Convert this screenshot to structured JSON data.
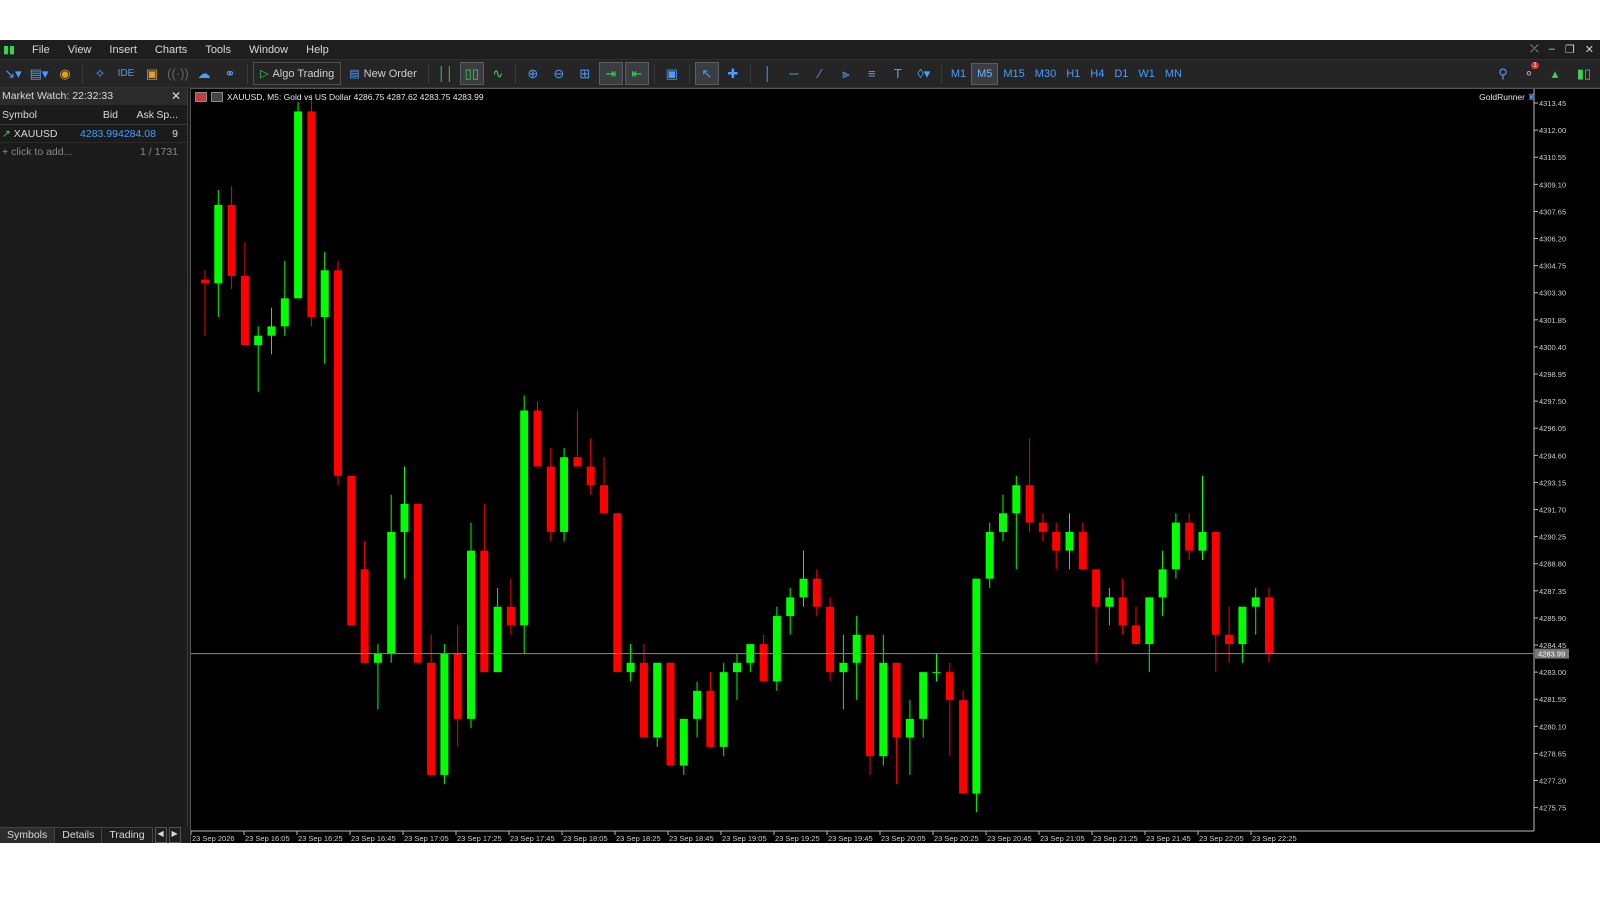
{
  "menu": {
    "items": [
      "File",
      "View",
      "Insert",
      "Charts",
      "Tools",
      "Window",
      "Help"
    ]
  },
  "toolbar": {
    "algo_trading": "Algo Trading",
    "new_order": "New Order",
    "ide": "IDE",
    "timeframes": [
      "M1",
      "M5",
      "M15",
      "M30",
      "H1",
      "H4",
      "D1",
      "W1",
      "MN"
    ],
    "active_timeframe": "M5",
    "notification_count": "1"
  },
  "market_watch": {
    "title": "Market Watch: 22:32:33",
    "columns": [
      "Symbol",
      "Bid",
      "Ask",
      "Sp..."
    ],
    "rows": [
      {
        "symbol": "XAUUSD",
        "bid": "4283.99",
        "ask": "4284.08",
        "spread": "9"
      }
    ],
    "add_text": "click to add...",
    "count": "1 / 1731",
    "tabs": [
      "Symbols",
      "Details",
      "Trading"
    ]
  },
  "chart": {
    "title": "XAUUSD, M5:  Gold vs US Dollar  4286.75 4287.62 4283.75 4283.99",
    "ea_name": "GoldRunner",
    "current_price": "4283.99",
    "colors": {
      "bull": "#00ff00",
      "bear": "#ff0000",
      "background": "#000000",
      "axis_text": "#cfcfcf"
    }
  },
  "chart_data": {
    "type": "candlestick",
    "ylim": [
      4274.5,
      4314.2
    ],
    "price_ticks": [
      "4313.45",
      "4312.00",
      "4310.55",
      "4309.10",
      "4307.65",
      "4306.20",
      "4304.75",
      "4303.30",
      "4301.85",
      "4300.40",
      "4298.95",
      "4297.50",
      "4296.05",
      "4294.60",
      "4293.15",
      "4291.70",
      "4290.25",
      "4288.80",
      "4287.35",
      "4285.90",
      "4284.45",
      "4283.00",
      "4281.55",
      "4280.10",
      "4278.65",
      "4277.20",
      "4275.75"
    ],
    "time_ticks": [
      "23 Sep 2026",
      "23 Sep 16:05",
      "23 Sep 16:25",
      "23 Sep 16:45",
      "23 Sep 17:05",
      "23 Sep 17:25",
      "23 Sep 17:45",
      "23 Sep 18:05",
      "23 Sep 18:25",
      "23 Sep 18:45",
      "23 Sep 19:05",
      "23 Sep 19:25",
      "23 Sep 19:45",
      "23 Sep 20:05",
      "23 Sep 20:25",
      "23 Sep 20:45",
      "23 Sep 21:05",
      "23 Sep 21:25",
      "23 Sep 21:45",
      "23 Sep 22:05",
      "23 Sep 22:25"
    ],
    "candles": [
      [
        4304.0,
        4304.5,
        4301.0,
        4303.8
      ],
      [
        4303.8,
        4308.8,
        4302.0,
        4308.0
      ],
      [
        4308.0,
        4309.0,
        4303.5,
        4304.2
      ],
      [
        4304.2,
        4306.0,
        4300.5,
        4300.5
      ],
      [
        4300.5,
        4301.5,
        4298.0,
        4301.0
      ],
      [
        4301.0,
        4302.5,
        4300.0,
        4301.5
      ],
      [
        4301.5,
        4305.0,
        4301.0,
        4303.0
      ],
      [
        4303.0,
        4313.5,
        4303.0,
        4313.0
      ],
      [
        4313.0,
        4313.9,
        4301.5,
        4302.0
      ],
      [
        4302.0,
        4305.5,
        4299.5,
        4304.5
      ],
      [
        4304.5,
        4305.0,
        4293.0,
        4293.5
      ],
      [
        4293.5,
        4290.2,
        4285.5,
        4285.5
      ],
      [
        4288.5,
        4290.0,
        4283.5,
        4283.5
      ],
      [
        4283.5,
        4284.5,
        4281.0,
        4284.0
      ],
      [
        4284.0,
        4292.5,
        4283.5,
        4290.5
      ],
      [
        4290.5,
        4294.0,
        4288.0,
        4292.0
      ],
      [
        4292.0,
        4292.0,
        4283.5,
        4283.5
      ],
      [
        4283.5,
        4285.0,
        4277.5,
        4277.5
      ],
      [
        4277.5,
        4284.5,
        4277.0,
        4284.0
      ],
      [
        4284.0,
        4285.5,
        4279.0,
        4280.5
      ],
      [
        4280.5,
        4291.0,
        4280.0,
        4289.5
      ],
      [
        4289.5,
        4292.0,
        4283.0,
        4283.0
      ],
      [
        4283.0,
        4287.5,
        4283.0,
        4286.5
      ],
      [
        4286.5,
        4288.0,
        4285.0,
        4285.5
      ],
      [
        4285.5,
        4297.8,
        4284.0,
        4297.0
      ],
      [
        4297.0,
        4297.5,
        4294.0,
        4294.0
      ],
      [
        4294.0,
        4295.0,
        4290.0,
        4290.5
      ],
      [
        4290.5,
        4295.0,
        4290.0,
        4294.5
      ],
      [
        4294.5,
        4297.0,
        4294.0,
        4294.0
      ],
      [
        4294.0,
        4295.5,
        4292.5,
        4293.0
      ],
      [
        4293.0,
        4294.5,
        4291.5,
        4291.5
      ],
      [
        4291.5,
        4291.5,
        4283.0,
        4283.0
      ],
      [
        4283.0,
        4284.5,
        4282.5,
        4283.5
      ],
      [
        4283.5,
        4284.5,
        4279.5,
        4279.5
      ],
      [
        4279.5,
        4283.5,
        4279.0,
        4283.5
      ],
      [
        4283.5,
        4283.5,
        4278.0,
        4278.0
      ],
      [
        4278.0,
        4280.5,
        4277.5,
        4280.5
      ],
      [
        4280.5,
        4282.5,
        4279.5,
        4282.0
      ],
      [
        4282.0,
        4283.0,
        4279.0,
        4279.0
      ],
      [
        4279.0,
        4283.5,
        4278.5,
        4283.0
      ],
      [
        4283.0,
        4284.0,
        4281.5,
        4283.5
      ],
      [
        4283.5,
        4284.5,
        4283.0,
        4284.5
      ],
      [
        4284.5,
        4285.0,
        4282.5,
        4282.5
      ],
      [
        4282.5,
        4286.5,
        4282.0,
        4286.0
      ],
      [
        4286.0,
        4287.5,
        4285.0,
        4287.0
      ],
      [
        4287.0,
        4289.5,
        4286.5,
        4288.0
      ],
      [
        4288.0,
        4288.5,
        4286.0,
        4286.5
      ],
      [
        4286.5,
        4287.0,
        4282.5,
        4283.0
      ],
      [
        4283.0,
        4285.0,
        4281.0,
        4283.5
      ],
      [
        4283.5,
        4286.0,
        4281.5,
        4285.0
      ],
      [
        4285.0,
        4285.0,
        4277.5,
        4278.5
      ],
      [
        4278.5,
        4285.0,
        4278.0,
        4283.5
      ],
      [
        4283.5,
        4283.5,
        4277.0,
        4279.5
      ],
      [
        4279.5,
        4281.5,
        4277.5,
        4280.5
      ],
      [
        4280.5,
        4283.0,
        4279.5,
        4283.0
      ],
      [
        4283.0,
        4284.0,
        4282.5,
        4283.0
      ],
      [
        4283.0,
        4283.5,
        4278.5,
        4281.5
      ],
      [
        4281.5,
        4282.0,
        4276.5,
        4276.5
      ],
      [
        4276.5,
        4288.0,
        4275.5,
        4288.0
      ],
      [
        4288.0,
        4291.0,
        4287.5,
        4290.5
      ],
      [
        4290.5,
        4292.5,
        4290.0,
        4291.5
      ],
      [
        4291.5,
        4293.5,
        4288.5,
        4293.0
      ],
      [
        4293.0,
        4295.5,
        4290.5,
        4291.0
      ],
      [
        4291.0,
        4291.5,
        4290.0,
        4290.5
      ],
      [
        4290.5,
        4291.0,
        4288.5,
        4289.5
      ],
      [
        4289.5,
        4291.5,
        4288.5,
        4290.5
      ],
      [
        4290.5,
        4291.0,
        4288.5,
        4288.5
      ],
      [
        4288.5,
        4288.5,
        4283.5,
        4286.5
      ],
      [
        4286.5,
        4287.5,
        4285.5,
        4287.0
      ],
      [
        4287.0,
        4288.0,
        4285.0,
        4285.5
      ],
      [
        4285.5,
        4286.5,
        4284.5,
        4284.5
      ],
      [
        4284.5,
        4287.0,
        4283.0,
        4287.0
      ],
      [
        4287.0,
        4289.5,
        4286.0,
        4288.5
      ],
      [
        4288.5,
        4291.5,
        4288.0,
        4291.0
      ],
      [
        4291.0,
        4291.5,
        4289.0,
        4289.5
      ],
      [
        4289.5,
        4293.5,
        4289.0,
        4290.5
      ],
      [
        4290.5,
        4290.5,
        4283.0,
        4285.0
      ],
      [
        4285.0,
        4286.5,
        4283.5,
        4284.5
      ],
      [
        4284.5,
        4286.5,
        4283.5,
        4286.5
      ],
      [
        4286.5,
        4287.5,
        4285.0,
        4287.0
      ],
      [
        4287.0,
        4287.5,
        4283.5,
        4284.0
      ]
    ]
  }
}
